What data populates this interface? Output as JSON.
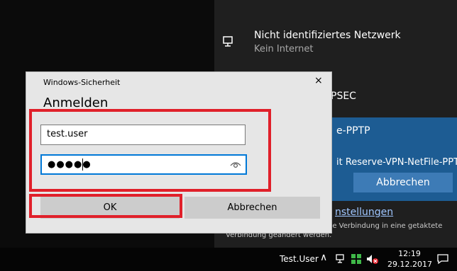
{
  "network": {
    "title": "Nicht identifiziertes Netzwerk",
    "subtitle": "Kein Internet",
    "vpn_ipsec_label": "PSEC",
    "vpn_pptp_label": "e-PPTP",
    "vpn_connecting_text": "it Reserve-VPN-NetFile-PPTP",
    "cancel_label": "Abbrechen",
    "settings_link": "nstellungen",
    "settings_description": "ngen. Beispielsweise kann eine Verbindung in eine getaktete Verbindung geändert werden.",
    "accent_color": "#1d5c93"
  },
  "dialog": {
    "window_title": "Windows-Sicherheit",
    "close_icon": "×",
    "heading": "Anmelden",
    "username_value": "test.user",
    "password_dots": "●●●●●",
    "ok_label": "OK",
    "cancel_label": "Abbrechen"
  },
  "taskbar": {
    "user": "Test.User",
    "chevron": "∧",
    "time": "12:19",
    "date": "29.12.2017"
  },
  "annotation": {
    "highlight_color": "#e0202a"
  }
}
